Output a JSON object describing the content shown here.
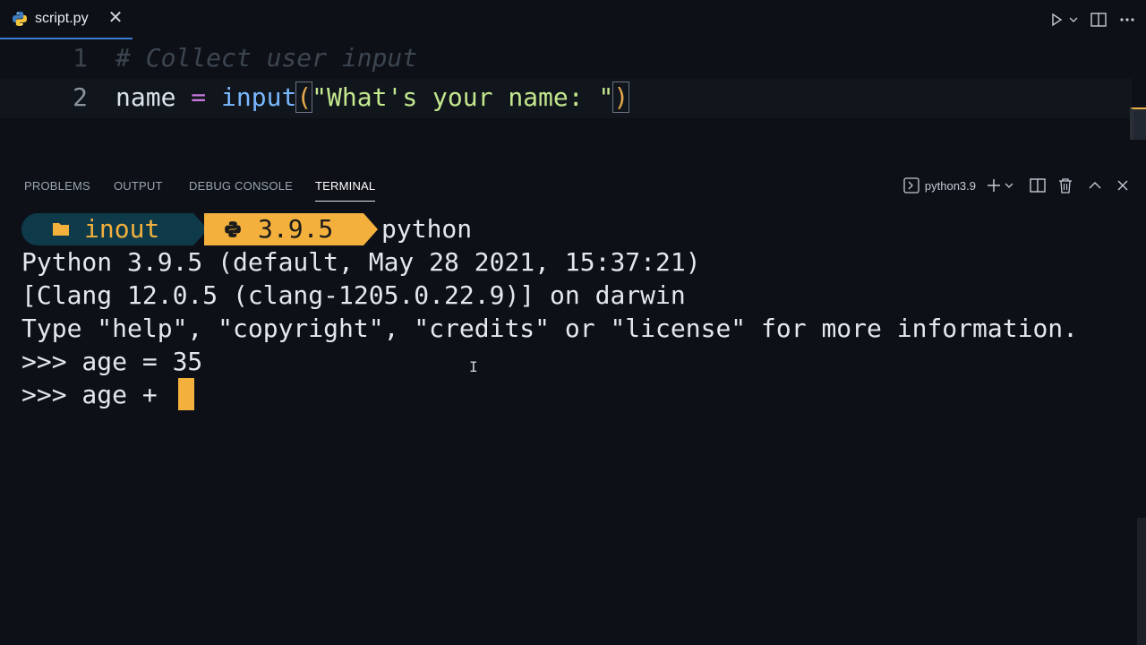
{
  "tab": {
    "file_name": "script.py",
    "close_glyph": "✕"
  },
  "editor": {
    "lines": [
      {
        "number": "1",
        "comment": "# Collect user input"
      },
      {
        "number": "2",
        "var": "name",
        "op": "=",
        "fn": "input",
        "open_paren": "(",
        "string": "\"What's your name: \"",
        "close_paren": ")"
      }
    ]
  },
  "panel": {
    "tabs": [
      "PROBLEMS",
      "OUTPUT",
      "DEBUG CONSOLE",
      "TERMINAL"
    ],
    "active_tab": "TERMINAL",
    "terminal_selector": "python3.9"
  },
  "terminal": {
    "prompt": {
      "directory": "inout",
      "python_version": "3.9.5",
      "command": "python"
    },
    "lines": [
      "Python 3.9.5 (default, May 28 2021, 15:37:21)",
      "[Clang 12.0.5 (clang-1205.0.22.9)] on darwin",
      "Type \"help\", \"copyright\", \"credits\" or \"license\" for more information.",
      ">>> age = 35",
      ">>> age + "
    ]
  },
  "colors": {
    "background": "#0d1117",
    "accent_yellow": "#f3b03c",
    "prompt_dir_bg": "#0f3a4a",
    "tab_underline": "#3a7bd5"
  },
  "icons": [
    "python-icon",
    "close-icon",
    "run-icon",
    "chevron-down-icon",
    "split-editor-icon",
    "more-icon",
    "terminal-icon",
    "plus-icon",
    "trash-icon",
    "chevron-up-icon",
    "folder-icon"
  ]
}
